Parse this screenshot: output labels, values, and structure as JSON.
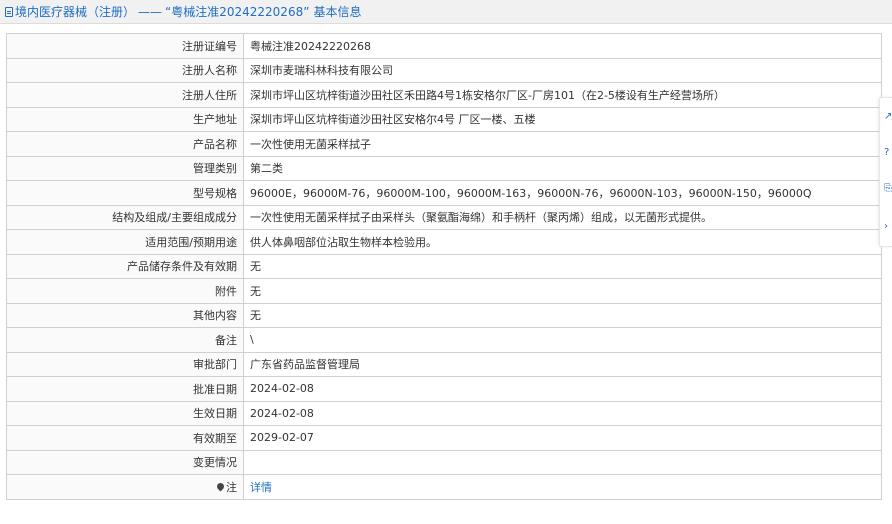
{
  "header": {
    "breadcrumb": "境内医疗器械（注册）",
    "separator": "——",
    "subject": "“粤械注准20242220268”",
    "suffix": "基本信息"
  },
  "rows": [
    {
      "label": "注册证编号",
      "value": "粤械注准20242220268"
    },
    {
      "label": "注册人名称",
      "value": "深圳市麦瑞科林科技有限公司"
    },
    {
      "label": "注册人住所",
      "value": "深圳市坪山区坑梓街道沙田社区禾田路4号1栋安格尔厂区-厂房101（在2-5楼设有生产经营场所）"
    },
    {
      "label": "生产地址",
      "value": "深圳市坪山区坑梓街道沙田社区安格尔4号 厂区一楼、五楼"
    },
    {
      "label": "产品名称",
      "value": "一次性使用无菌采样拭子"
    },
    {
      "label": "管理类别",
      "value": "第二类"
    },
    {
      "label": "型号规格",
      "value": "96000E，96000M-76，96000M-100，96000M-163，96000N-76，96000N-103，96000N-150，96000Q"
    },
    {
      "label": "结构及组成/主要组成成分",
      "value": "一次性使用无菌采样拭子由采样头（聚氨酯海绵）和手柄杆（聚丙烯）组成，以无菌形式提供。"
    },
    {
      "label": "适用范围/预期用途",
      "value": "供人体鼻咽部位沾取生物样本检验用。"
    },
    {
      "label": "产品储存条件及有效期",
      "value": "无"
    },
    {
      "label": "附件",
      "value": "无"
    },
    {
      "label": "其他内容",
      "value": "无"
    },
    {
      "label": "备注",
      "value": "\\"
    },
    {
      "label": "审批部门",
      "value": "广东省药品监督管理局"
    },
    {
      "label": "批准日期",
      "value": "2024-02-08"
    },
    {
      "label": "生效日期",
      "value": "2024-02-08"
    },
    {
      "label": "有效期至",
      "value": "2029-02-07"
    },
    {
      "label": "变更情况",
      "value": ""
    }
  ],
  "note_row": {
    "label": "注",
    "link_text": "详情"
  },
  "side_tools": [
    "export-icon",
    "help-icon",
    "copy-icon",
    "collapse-icon"
  ],
  "colors": {
    "link": "#1f6dc2",
    "border": "#d0d0d0",
    "header_bg": "#f1f1f1"
  }
}
